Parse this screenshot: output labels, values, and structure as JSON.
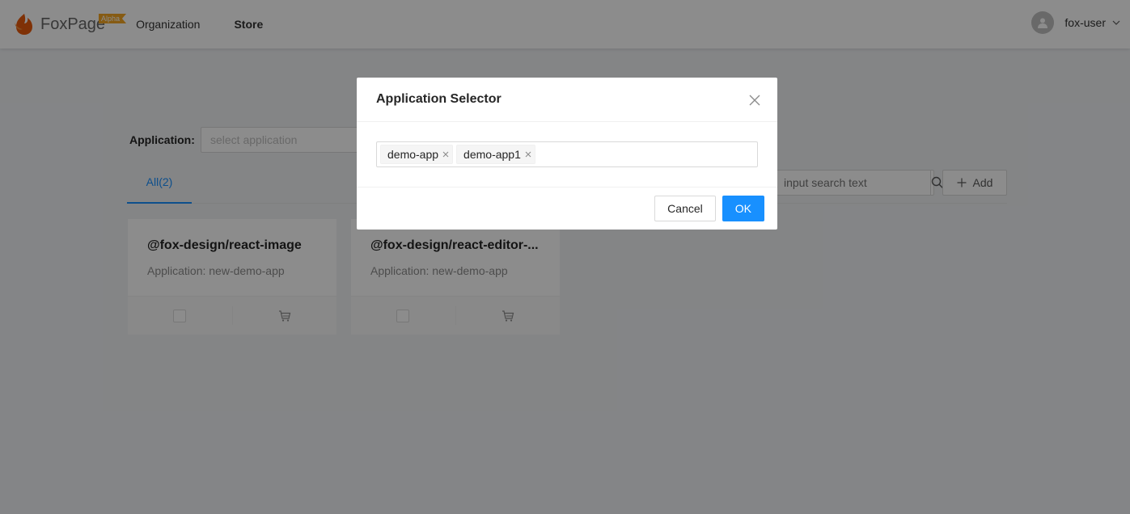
{
  "header": {
    "logo_text_bold": "Fox",
    "logo_text": "Page",
    "badge": "Alpha",
    "nav": [
      {
        "label": "Organization"
      },
      {
        "label": "Store"
      }
    ],
    "user_name": "fox-user"
  },
  "filter": {
    "label": "Application:",
    "placeholder": "select application"
  },
  "tabs": [
    {
      "label": "All(2)"
    }
  ],
  "search": {
    "placeholder": "input search text"
  },
  "add_label": "Add",
  "cards": [
    {
      "title": "@fox-design/react-image",
      "subtitle": "Application: new-demo-app"
    },
    {
      "title": "@fox-design/react-editor-...",
      "subtitle": "Application: new-demo-app"
    }
  ],
  "modal": {
    "title": "Application Selector",
    "selected": [
      {
        "label": "demo-app"
      },
      {
        "label": "demo-app1"
      }
    ],
    "cancel_label": "Cancel",
    "ok_label": "OK"
  },
  "colors": {
    "primary": "#1890ff",
    "badge": "#f5a623",
    "logo": "#e8590c"
  }
}
